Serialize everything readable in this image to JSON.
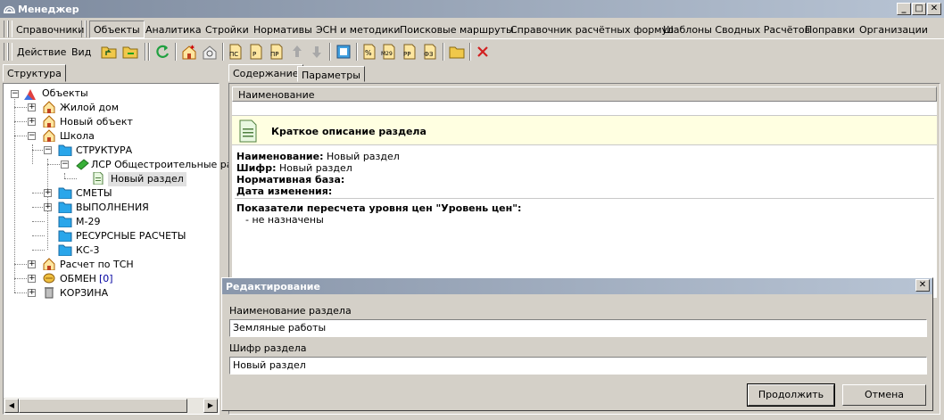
{
  "window": {
    "title": "Менеджер"
  },
  "menu": {
    "items": [
      "Справочники",
      "Объекты",
      "Аналитика",
      "Стройки",
      "Нормативы",
      "ЭСН и методики",
      "Поисковые маршруты",
      "Справочник расчётных формул",
      "Шаблоны Сводных Расчётов",
      "Поправки",
      "Организации"
    ],
    "active": "Объекты"
  },
  "toolbar": {
    "action_label": "Действие",
    "view_label": "Вид",
    "icons": {
      "b1": "ПС",
      "b2": "Р",
      "b3": "ПР",
      "b4": "%",
      "b5": "М29",
      "b6": "РР",
      "b7": "ФЗ"
    }
  },
  "left": {
    "tab": "Структура",
    "tree": {
      "root": "Объекты",
      "zhiloy": "Жилой дом",
      "noviy": "Новый объект",
      "shkola": "Школа",
      "struktura": "СТРУКТУРА",
      "lsr": "ЛСР Общестроительные ра",
      "razdel": "Новый раздел",
      "smety": "СМЕТЫ",
      "vypolneniya": "ВЫПОЛНЕНИЯ",
      "m29": "М-29",
      "resursnye": "РЕСУРСНЫЕ РАСЧЕТЫ",
      "ks3": "КС-3",
      "raschet": "Расчет по ТСН",
      "obmen": "ОБМЕН",
      "obmen_count": "[0]",
      "korzina": "КОРЗИНА"
    }
  },
  "right": {
    "tabs": [
      "Содержание",
      "Параметры"
    ],
    "column_header": "Наименование",
    "card_title": "Краткое описание раздела",
    "fields": [
      {
        "label": "Наименование:",
        "value": "Новый раздел"
      },
      {
        "label": "Шифр:",
        "value": "Новый раздел"
      },
      {
        "label": "Нормативная база:",
        "value": ""
      },
      {
        "label": "Дата изменения:",
        "value": ""
      }
    ],
    "price_title": "Показатели пересчета уровня цен \"Уровень цен\":",
    "price_value": "- не назначены"
  },
  "dialog": {
    "title": "Редактирование",
    "name_label": "Наименование раздела",
    "name_value": "Земляные работы",
    "code_label": "Шифр раздела",
    "code_value": "Новый раздел",
    "continue": "Продолжить",
    "cancel": "Отмена"
  },
  "colors": {
    "title_bar": "#7d8a9e",
    "card_bg": "#ffffe1",
    "folder_blue": "#2aa6ea",
    "close_red": "#d22020"
  }
}
